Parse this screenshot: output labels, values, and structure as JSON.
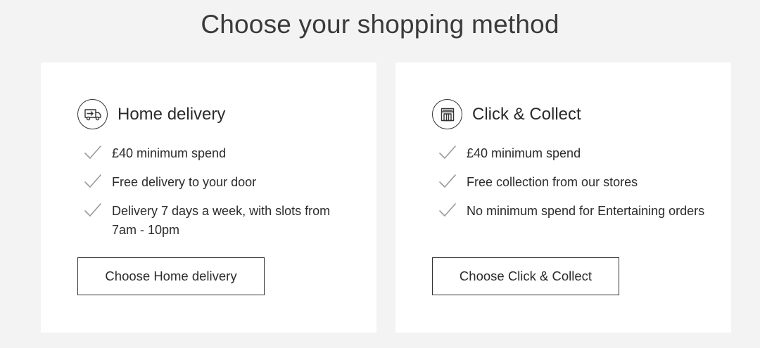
{
  "page": {
    "title": "Choose your shopping method"
  },
  "options": [
    {
      "icon": "delivery-van-icon",
      "title": "Home delivery",
      "features": [
        "£40 minimum spend",
        "Free delivery to your door",
        "Delivery 7 days a week, with slots from 7am - 10pm"
      ],
      "button_label": "Choose Home delivery"
    },
    {
      "icon": "store-front-icon",
      "title": "Click & Collect",
      "features": [
        "£40 minimum spend",
        "Free collection from our stores",
        "No minimum spend for Entertaining orders"
      ],
      "button_label": "Choose Click & Collect"
    }
  ],
  "colors": {
    "background": "#f3f3f3",
    "card": "#ffffff",
    "text": "#2b2b2b",
    "check": "#9a9a9a",
    "border": "#333333"
  }
}
